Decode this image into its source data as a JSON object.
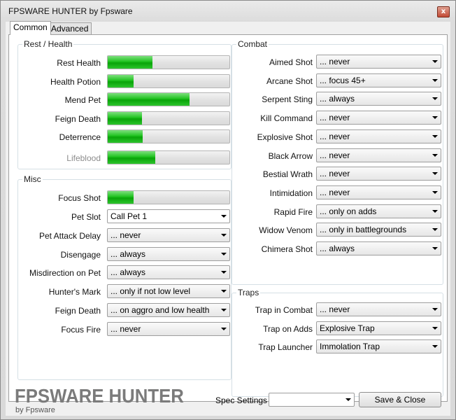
{
  "window": {
    "title": "FPSWARE HUNTER by Fpsware",
    "close_glyph": "x"
  },
  "tabs": [
    {
      "label": "Common",
      "active": true
    },
    {
      "label": "Advanced",
      "active": false
    }
  ],
  "rest_health": {
    "title": "Rest / Health",
    "items": [
      {
        "label": "Rest Health",
        "value": 0.37
      },
      {
        "label": "Health Potion",
        "value": 0.21
      },
      {
        "label": "Mend Pet",
        "value": 0.67
      },
      {
        "label": "Feign Death",
        "value": 0.28
      },
      {
        "label": "Deterrence",
        "value": 0.29
      },
      {
        "label": "Lifeblood",
        "value": 0.39,
        "disabled": true
      }
    ]
  },
  "misc": {
    "title": "Misc",
    "focus_shot": {
      "label": "Focus Shot",
      "value": 0.21
    },
    "pet_slot": {
      "label": "Pet Slot",
      "value": "Call Pet 1"
    },
    "items": [
      {
        "label": "Pet Attack Delay",
        "value": "... never"
      },
      {
        "label": "Disengage",
        "value": "... always"
      },
      {
        "label": "Misdirection on Pet",
        "value": "... always"
      },
      {
        "label": "Hunter's Mark",
        "value": "... only if not low level"
      },
      {
        "label": "Feign Death",
        "value": "... on aggro and low health"
      },
      {
        "label": "Focus Fire",
        "value": "... never"
      }
    ]
  },
  "combat": {
    "title": "Combat",
    "items": [
      {
        "label": "Aimed Shot",
        "value": "... never"
      },
      {
        "label": "Arcane Shot",
        "value": "... focus 45+"
      },
      {
        "label": "Serpent Sting",
        "value": "... always"
      },
      {
        "label": "Kill Command",
        "value": "... never"
      },
      {
        "label": "Explosive Shot",
        "value": "... never"
      },
      {
        "label": "Black Arrow",
        "value": "... never"
      },
      {
        "label": "Bestial Wrath",
        "value": "... never"
      },
      {
        "label": "Intimidation",
        "value": "... never"
      },
      {
        "label": "Rapid Fire",
        "value": "... only on adds"
      },
      {
        "label": "Widow Venom",
        "value": "... only in battlegrounds"
      },
      {
        "label": "Chimera Shot",
        "value": "... always"
      }
    ]
  },
  "traps": {
    "title": "Traps",
    "items": [
      {
        "label": "Trap in Combat",
        "value": "... never"
      },
      {
        "label": "Trap on Adds",
        "value": "Explosive Trap"
      },
      {
        "label": "Trap Launcher",
        "value": "Immolation Trap"
      }
    ]
  },
  "footer": {
    "logo_main": "FPSWARE HUNTER",
    "logo_sub": "by Fpsware",
    "spec_label": "Spec Settings",
    "spec_value": "",
    "save_close": "Save & Close"
  },
  "colors": {
    "bar_fill": "#18c018",
    "group_border": "#d5dfe5"
  }
}
